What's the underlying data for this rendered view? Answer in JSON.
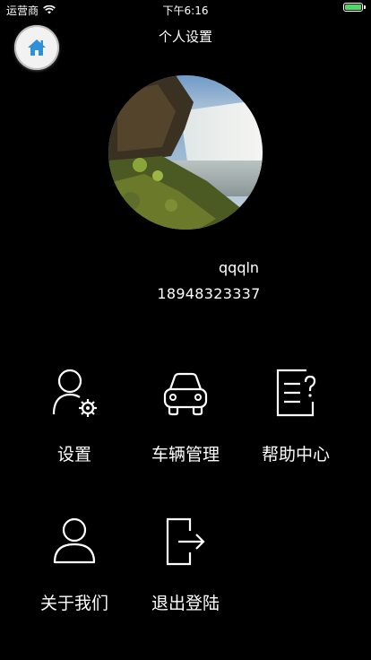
{
  "status_bar": {
    "carrier": "运营商",
    "time": "下午6:16",
    "battery_color": "#4cd964"
  },
  "nav": {
    "title": "个人设置",
    "home_icon": "home-icon"
  },
  "profile": {
    "avatar": "waterfall-landscape-photo",
    "username": "qqqln",
    "phone": "18948323337"
  },
  "menu": [
    {
      "label": "设置",
      "icon": "user-settings-icon"
    },
    {
      "label": "车辆管理",
      "icon": "car-icon"
    },
    {
      "label": "帮助中心",
      "icon": "help-document-icon"
    },
    {
      "label": "关于我们",
      "icon": "user-icon"
    },
    {
      "label": "退出登陆",
      "icon": "logout-icon"
    }
  ],
  "colors": {
    "background": "#000000",
    "text": "#ffffff",
    "home_icon": "#2f8fd8"
  }
}
